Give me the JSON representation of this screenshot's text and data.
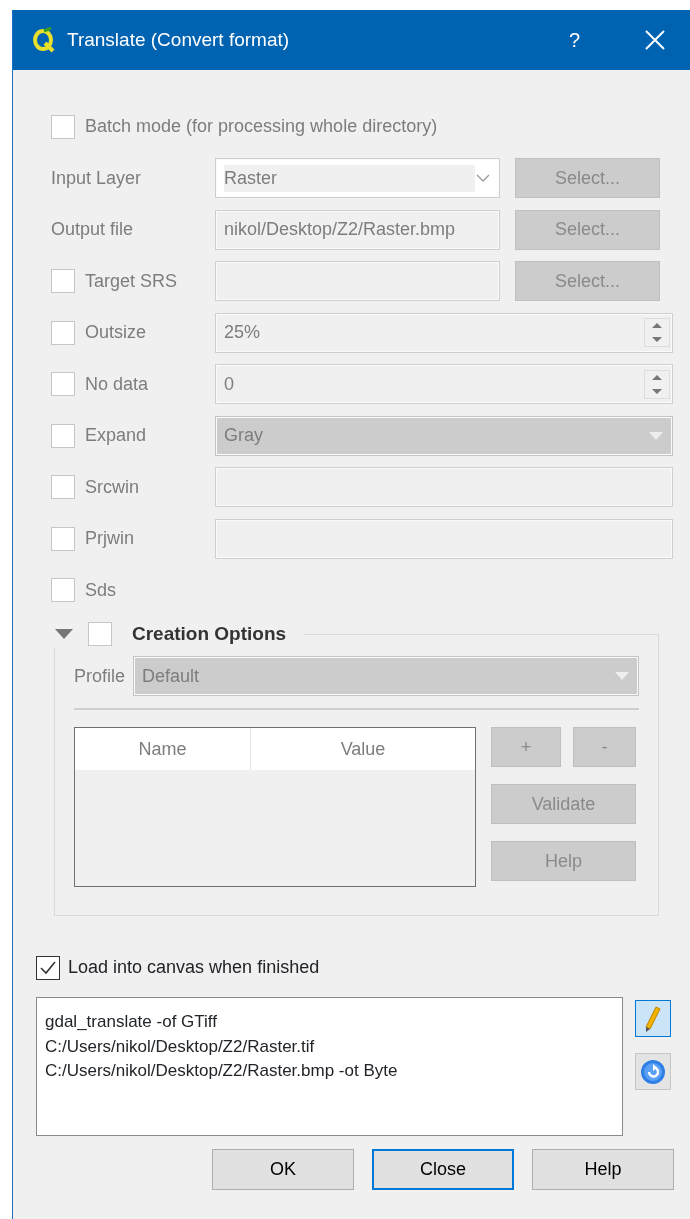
{
  "window": {
    "title": "Translate (Convert format)",
    "help_button": "?"
  },
  "parameters": {
    "disabled": true,
    "rows": [
      {
        "kind": "checkbox",
        "label": "Batch mode (for processing whole directory)",
        "checked": false
      },
      {
        "kind": "combo",
        "label": "Input Layer",
        "value": "Raster",
        "button": "Select..."
      },
      {
        "kind": "text",
        "label": "Output file",
        "value": "nikol/Desktop/Z2/Raster.bmp",
        "button": "Select..."
      },
      {
        "kind": "text",
        "label": "Target SRS",
        "checked": false,
        "button": "Select..."
      },
      {
        "kind": "spin",
        "label": "Outsize",
        "checked": false,
        "value": "25%"
      },
      {
        "kind": "spin",
        "label": "No data",
        "checked": false,
        "value": "0"
      },
      {
        "kind": "dropdown",
        "label": "Expand",
        "checked": false,
        "value": "Gray"
      },
      {
        "kind": "text",
        "label": "Srcwin",
        "checked": false
      },
      {
        "kind": "text",
        "label": "Prjwin",
        "checked": false
      },
      {
        "kind": "checkbox",
        "label": "Sds",
        "checked": false
      }
    ]
  },
  "creation_options": {
    "title": "Creation Options",
    "expanded": true,
    "checked": false,
    "profile_label": "Profile",
    "profile": "Default",
    "columns": [
      "Name",
      "Value"
    ],
    "buttons": [
      "+",
      "-",
      "Validate",
      "Help"
    ]
  },
  "load_into_canvas": {
    "label": "Load into canvas when finished",
    "checked": true
  },
  "command": {
    "lines": [
      "gdal_translate -of GTiff",
      "C:/Users/nikol/Desktop/Z2/Raster.tif",
      "C:/Users/nikol/Desktop/Z2/Raster.bmp -ot Byte"
    ],
    "edit_on": true
  },
  "dialog_buttons": [
    {
      "label": "OK",
      "focused": false
    },
    {
      "label": "Close",
      "focused": true
    },
    {
      "label": "Help",
      "focused": false
    }
  ]
}
